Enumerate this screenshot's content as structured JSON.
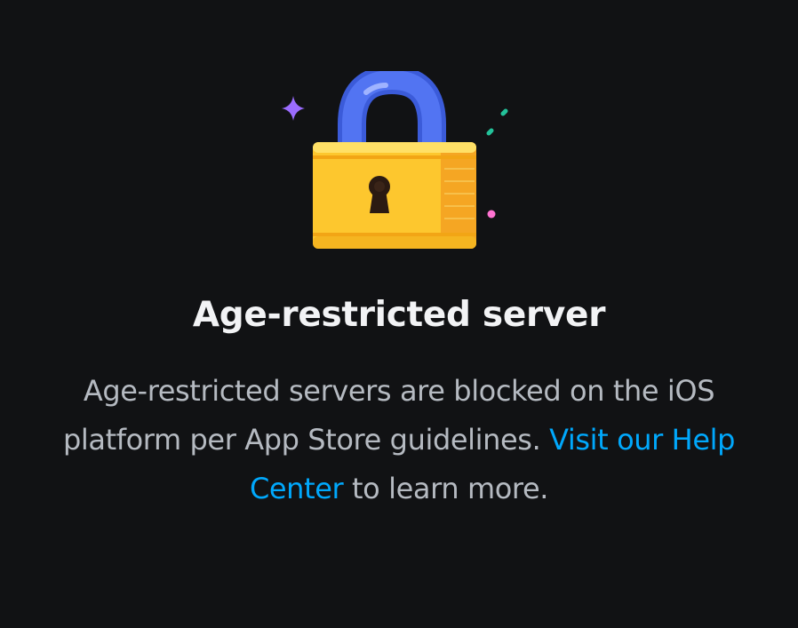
{
  "icons": {
    "illustration": "padlock-icon",
    "sparkle": "sparkle-icon"
  },
  "colors": {
    "background": "#111214",
    "title": "#f2f3f5",
    "body_text": "#b5bac1",
    "link": "#00a8fc",
    "lock_body": "#fdc72e",
    "lock_shackle": "#4f6df0",
    "sparkle_purple": "#9b6cff",
    "sparkle_green": "#23c29a",
    "sparkle_pink": "#ff73d2"
  },
  "gate": {
    "title": "Age-restricted server",
    "description_before": "Age-restricted servers are blocked on the iOS platform per App Store guidelines. ",
    "link_text": "Visit our Help Center",
    "description_after": " to learn more."
  }
}
